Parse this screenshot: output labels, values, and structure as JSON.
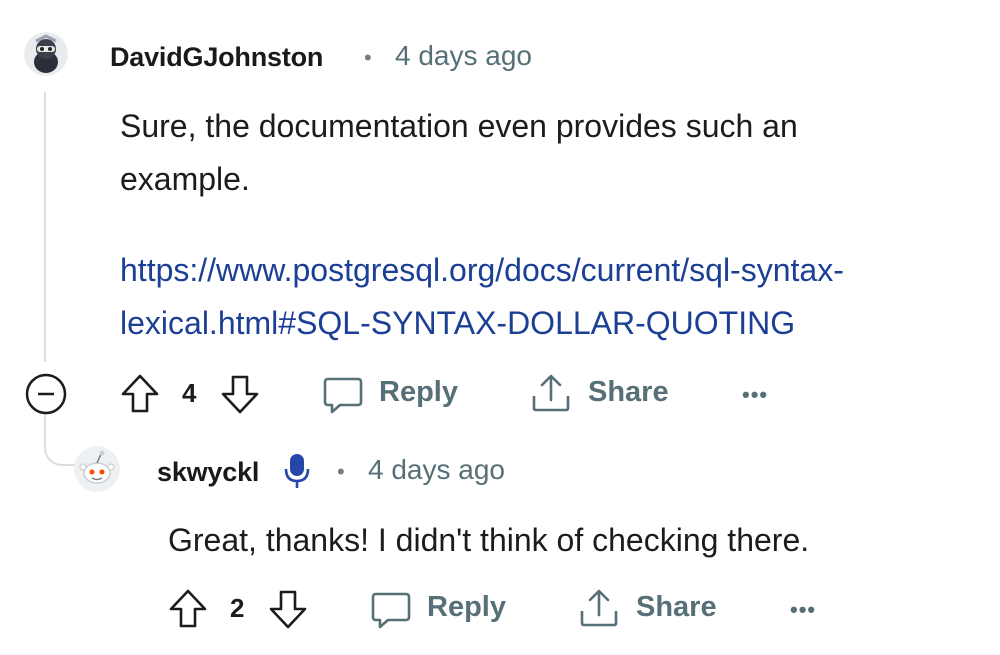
{
  "comments": [
    {
      "username": "DavidGJohnston",
      "separator": "•",
      "timestamp": "4 days ago",
      "body_lines": [
        "Sure, the documentation even provides such an",
        "example."
      ],
      "link_lines": [
        "https://www.postgresql.org/docs/current/sql-syntax-",
        "lexical.html#SQL-SYNTAX-DOLLAR-QUOTING"
      ],
      "votes": "4",
      "reply_label": "Reply",
      "share_label": "Share",
      "more_label": "•••"
    },
    {
      "username": "skwyckl",
      "separator": "•",
      "timestamp": "4 days ago",
      "body_lines": [
        "Great, thanks! I didn't think of checking there."
      ],
      "votes": "2",
      "reply_label": "Reply",
      "share_label": "Share",
      "more_label": "•••"
    }
  ],
  "colors": {
    "link": "#1c3f96",
    "meta": "#576f76",
    "thread_line": "#d9dde0",
    "mic_badge": "#2646a8"
  },
  "icons": {
    "collapse": "collapse-minus-icon",
    "upvote": "upvote-arrow-icon",
    "downvote": "downvote-arrow-icon",
    "reply": "speech-bubble-icon",
    "share": "share-upload-icon",
    "more": "more-dots-icon",
    "mic": "microphone-icon"
  }
}
